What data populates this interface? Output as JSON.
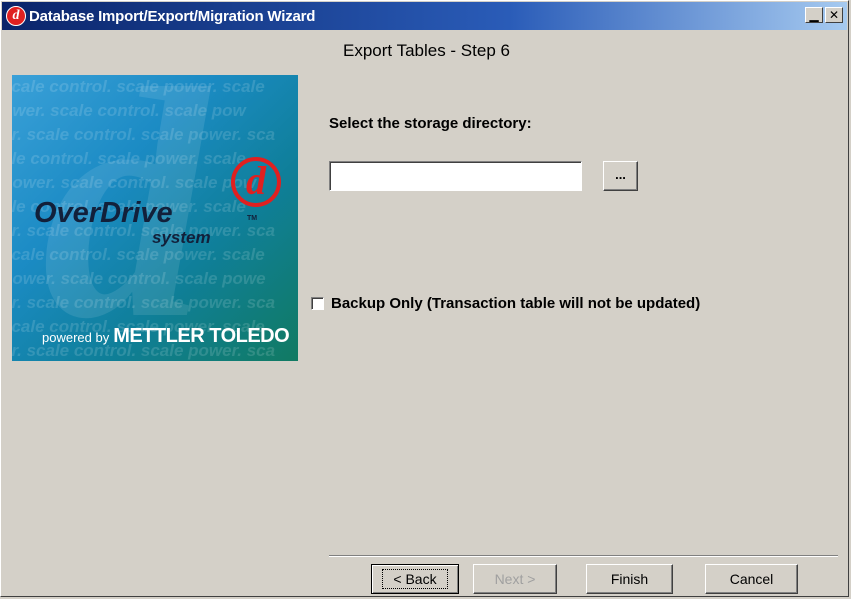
{
  "window": {
    "title": "Database Import/Export/Migration Wizard",
    "icon": "overdrive-d-icon",
    "controls": {
      "minimize": "▁",
      "close": "✕"
    }
  },
  "wizard": {
    "step_title": "Export Tables - Step 6"
  },
  "logo": {
    "pattern_lines": [
      "scale control. scale power. scale",
      "ower. scale control. scale pow",
      "er. scale control. scale power. sca",
      "ale control. scale power. scale",
      "power. scale control. scale pow",
      "ale control. scale power. scale",
      "er. scale control. scale power. sca",
      "scale control. scale power. scale",
      "power. scale control. scale powe",
      "er. scale control. scale power. sca",
      "scale control. scale power. scale",
      "er. scale control. scale power. sca"
    ],
    "mark": "d",
    "product_name": "OverDrive",
    "trademark": "TM",
    "product_sub": "system",
    "powered_by": "powered by",
    "brand": "METTLER TOLEDO"
  },
  "form": {
    "directory_label": "Select the storage directory:",
    "directory_value": "",
    "browse_label": "...",
    "backup_only_label": "Backup Only (Transaction table will not be updated)",
    "backup_only_checked": false
  },
  "buttons": {
    "back": "< Back",
    "next": "Next >",
    "finish": "Finish",
    "cancel": "Cancel"
  }
}
